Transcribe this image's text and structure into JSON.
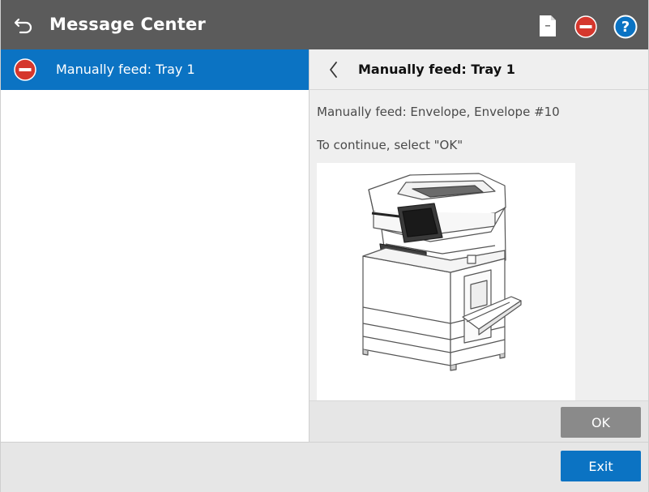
{
  "header": {
    "title": "Message Center",
    "icons": [
      "back-arrow-icon",
      "document-icon",
      "stop-icon",
      "help-icon"
    ],
    "help_symbol": "?"
  },
  "message_list": {
    "items": [
      {
        "label": "Manually feed: Tray 1",
        "icon": "stop-icon",
        "selected": true
      }
    ]
  },
  "detail": {
    "title": "Manually feed: Tray 1",
    "line1": "Manually feed: Envelope, Envelope #10",
    "line2": "To continue, select \"OK\"",
    "image": "printer-illustration",
    "ok_label": "OK"
  },
  "footer": {
    "exit_label": "Exit"
  },
  "colors": {
    "header_bg": "#5b5b5b",
    "selected_bg": "#0b73c3",
    "stop_red": "#d5372d",
    "help_blue": "#0b73c3",
    "ok_bg": "#8a8a8a",
    "exit_bg": "#0b73c3"
  }
}
